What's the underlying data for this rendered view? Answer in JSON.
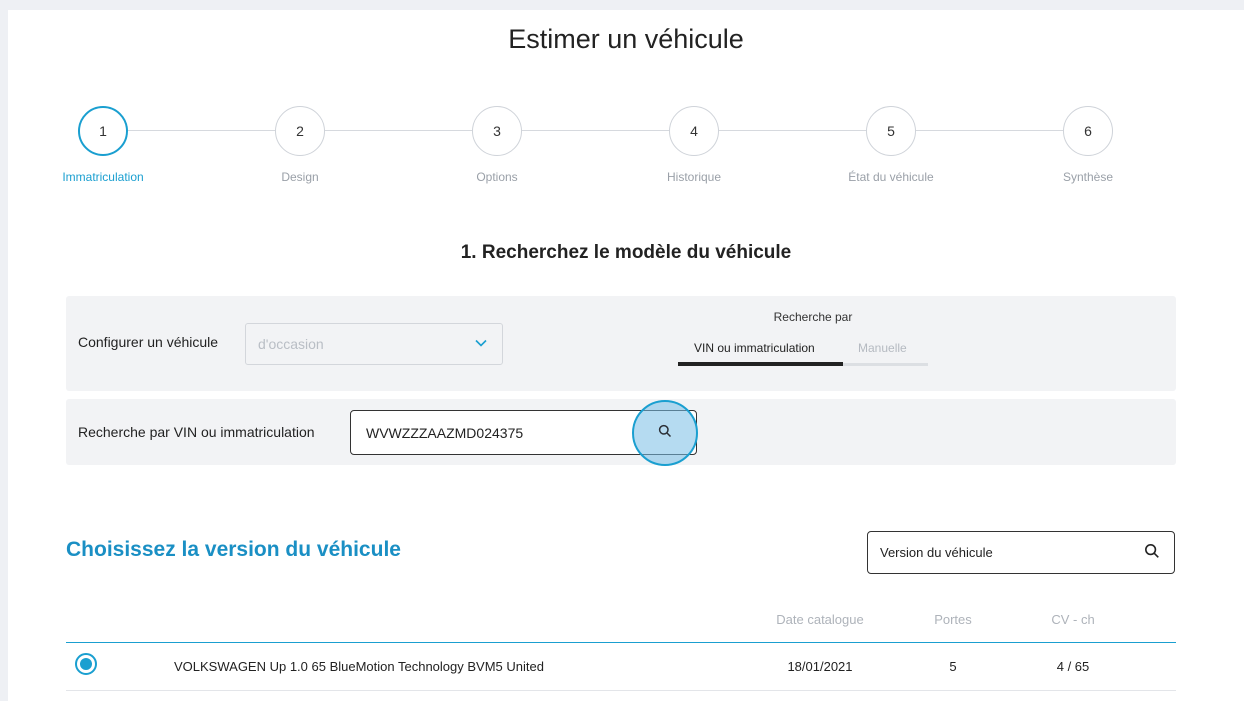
{
  "page": {
    "title": "Estimer un véhicule"
  },
  "stepper": {
    "steps": [
      {
        "number": "1",
        "label": "Immatriculation",
        "active": true
      },
      {
        "number": "2",
        "label": "Design",
        "active": false
      },
      {
        "number": "3",
        "label": "Options",
        "active": false
      },
      {
        "number": "4",
        "label": "Historique",
        "active": false
      },
      {
        "number": "5",
        "label": "État du véhicule",
        "active": false
      },
      {
        "number": "6",
        "label": "Synthèse",
        "active": false
      }
    ]
  },
  "search_section": {
    "title": "1. Recherchez le modèle du véhicule",
    "configure_label": "Configurer un véhicule",
    "configure_placeholder": "d'occasion",
    "search_by_title": "Recherche par",
    "tabs": [
      {
        "label": "VIN ou immatriculation",
        "selected": true
      },
      {
        "label": "Manuelle",
        "selected": false
      }
    ],
    "vin_label": "Recherche par VIN ou immatriculation",
    "vin_value": "WVWZZZAAZMD024375"
  },
  "versions": {
    "title": "Choisissez la version du véhicule",
    "search_placeholder": "Version du véhicule",
    "columns": {
      "date": "Date catalogue",
      "portes": "Portes",
      "cv": "CV - ch"
    },
    "rows": [
      {
        "name": "VOLKSWAGEN Up 1.0 65 BlueMotion Technology BVM5 United",
        "date": "18/01/2021",
        "portes": "5",
        "cv": "4 / 65",
        "selected": true
      }
    ]
  },
  "colors": {
    "accent": "#1a9fd0",
    "panel": "#f2f3f5",
    "background": "#eef0f4"
  },
  "icons": {
    "search": "search-icon",
    "dropdown": "chevron-down-icon"
  }
}
